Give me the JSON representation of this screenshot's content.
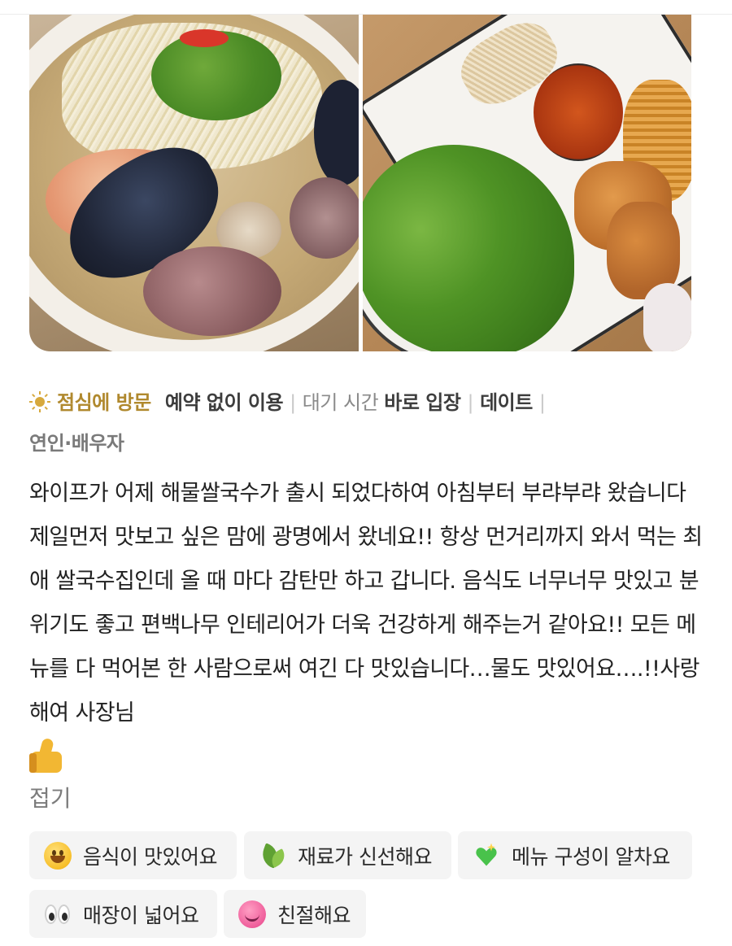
{
  "photos": [
    {
      "icon": "noodle-soup-photo"
    },
    {
      "icon": "herbs-and-fried-food-photo"
    }
  ],
  "visit_info": {
    "time_label": "점심에 방문",
    "reservation": "예약 없이 이용",
    "wait_label": "대기 시간",
    "wait_value": "바로 입장",
    "purpose": "데이트",
    "companion": "연인·배우자",
    "accent_color": "#b0892e"
  },
  "review": {
    "text": "와이프가 어제 해물쌀국수가 출시 되었다하여 아침부터 부랴부랴 왔습니다 제일먼저 맛보고 싶은 맘에 광명에서 왔네요!! 항상 먼거리까지 와서 먹는 최애 쌀국수집인데 올 때 마다 감탄만 하고 갑니다. 음식도 너무너무 맛있고 분위기도 좋고 편백나무 인테리어가 더욱 건강하게 해주는거 같아요!! 모든 메뉴를 다 먹어본 한 사람으로써 여긴 다 맛있습니다…물도 맛있어요….!!사랑해여 사장님",
    "emoji": "👍",
    "fold_label": "접기"
  },
  "keywords": [
    {
      "label": "음식이 맛있어요",
      "icon": "smile-icon"
    },
    {
      "label": "재료가 신선해요",
      "icon": "leaf-icon"
    },
    {
      "label": "메뉴 구성이 알차요",
      "icon": "sparkle-heart-icon"
    },
    {
      "label": "매장이 넓어요",
      "icon": "eyes-icon"
    },
    {
      "label": "친절해요",
      "icon": "smiling-face-icon"
    }
  ]
}
